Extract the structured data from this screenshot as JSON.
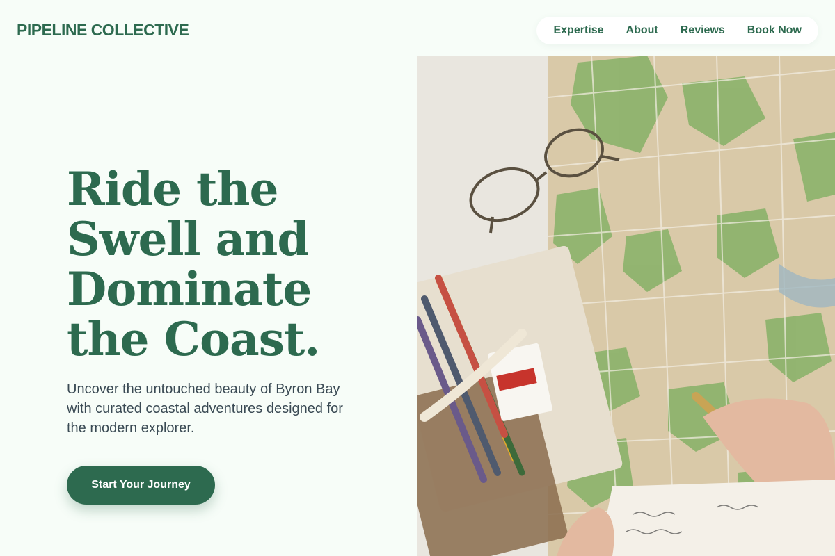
{
  "brand": {
    "name": "PIPELINE COLLECTIVE"
  },
  "nav": {
    "items": [
      "Expertise",
      "About",
      "Reviews",
      "Book Now"
    ]
  },
  "hero": {
    "title": "Ride the Swell and Dominate the Coast.",
    "subtitle": "Uncover the untouched beauty of Byron Bay with curated coastal adventures designed for the modern explorer.",
    "cta_label": "Start Your Journey"
  },
  "colors": {
    "accent": "#2d6a4f",
    "background": "#f7fdf8",
    "body_text": "#3a4a54"
  },
  "image": {
    "subject": "travel-planning-photo"
  }
}
